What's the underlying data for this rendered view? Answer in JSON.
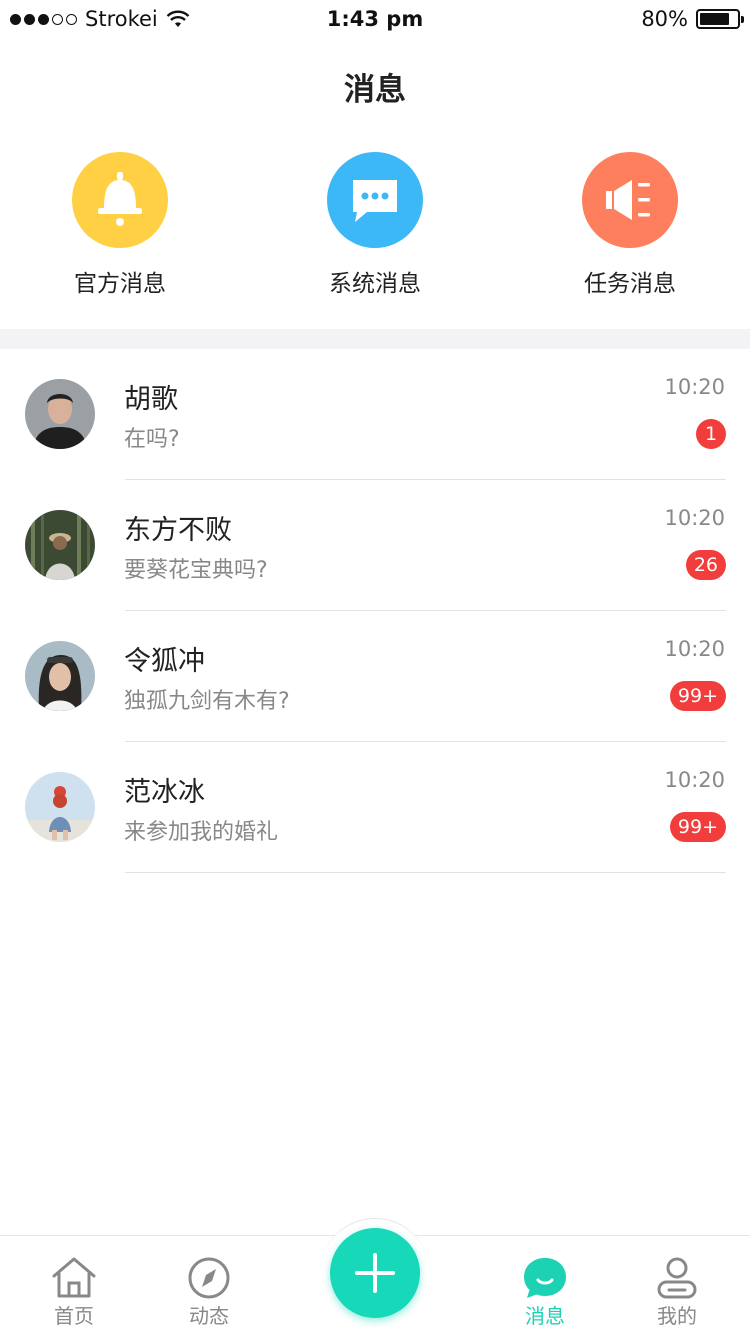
{
  "status_bar": {
    "carrier": "Strokei",
    "time": "1:43 pm",
    "battery_text": "80%",
    "battery_level": 0.8
  },
  "header": {
    "title": "消息"
  },
  "categories": [
    {
      "label": "官方消息",
      "icon": "bell-icon",
      "color": "#ffd044"
    },
    {
      "label": "系统消息",
      "icon": "chat-bubble-icon",
      "color": "#3cb8f6"
    },
    {
      "label": "任务消息",
      "icon": "speaker-icon",
      "color": "#fe7f5e"
    }
  ],
  "messages": [
    {
      "name": "胡歌",
      "preview": "在吗?",
      "time": "10:20",
      "badge": "1"
    },
    {
      "name": "东方不败",
      "preview": "要葵花宝典吗?",
      "time": "10:20",
      "badge": "26"
    },
    {
      "name": "令狐冲",
      "preview": "独孤九剑有木有?",
      "time": "10:20",
      "badge": "99+"
    },
    {
      "name": "范冰冰",
      "preview": "来参加我的婚礼",
      "time": "10:20",
      "badge": "99+"
    }
  ],
  "tab_bar": {
    "tabs": [
      {
        "label": "首页",
        "icon": "home-icon"
      },
      {
        "label": "动态",
        "icon": "compass-icon"
      },
      {
        "label": "消息",
        "icon": "message-icon",
        "active": true
      },
      {
        "label": "我的",
        "icon": "user-icon"
      }
    ],
    "fab_icon": "plus-icon",
    "active_color": "#1dd2b3"
  },
  "colors": {
    "badge": "#f23d3d",
    "accent": "#17d8b9"
  }
}
